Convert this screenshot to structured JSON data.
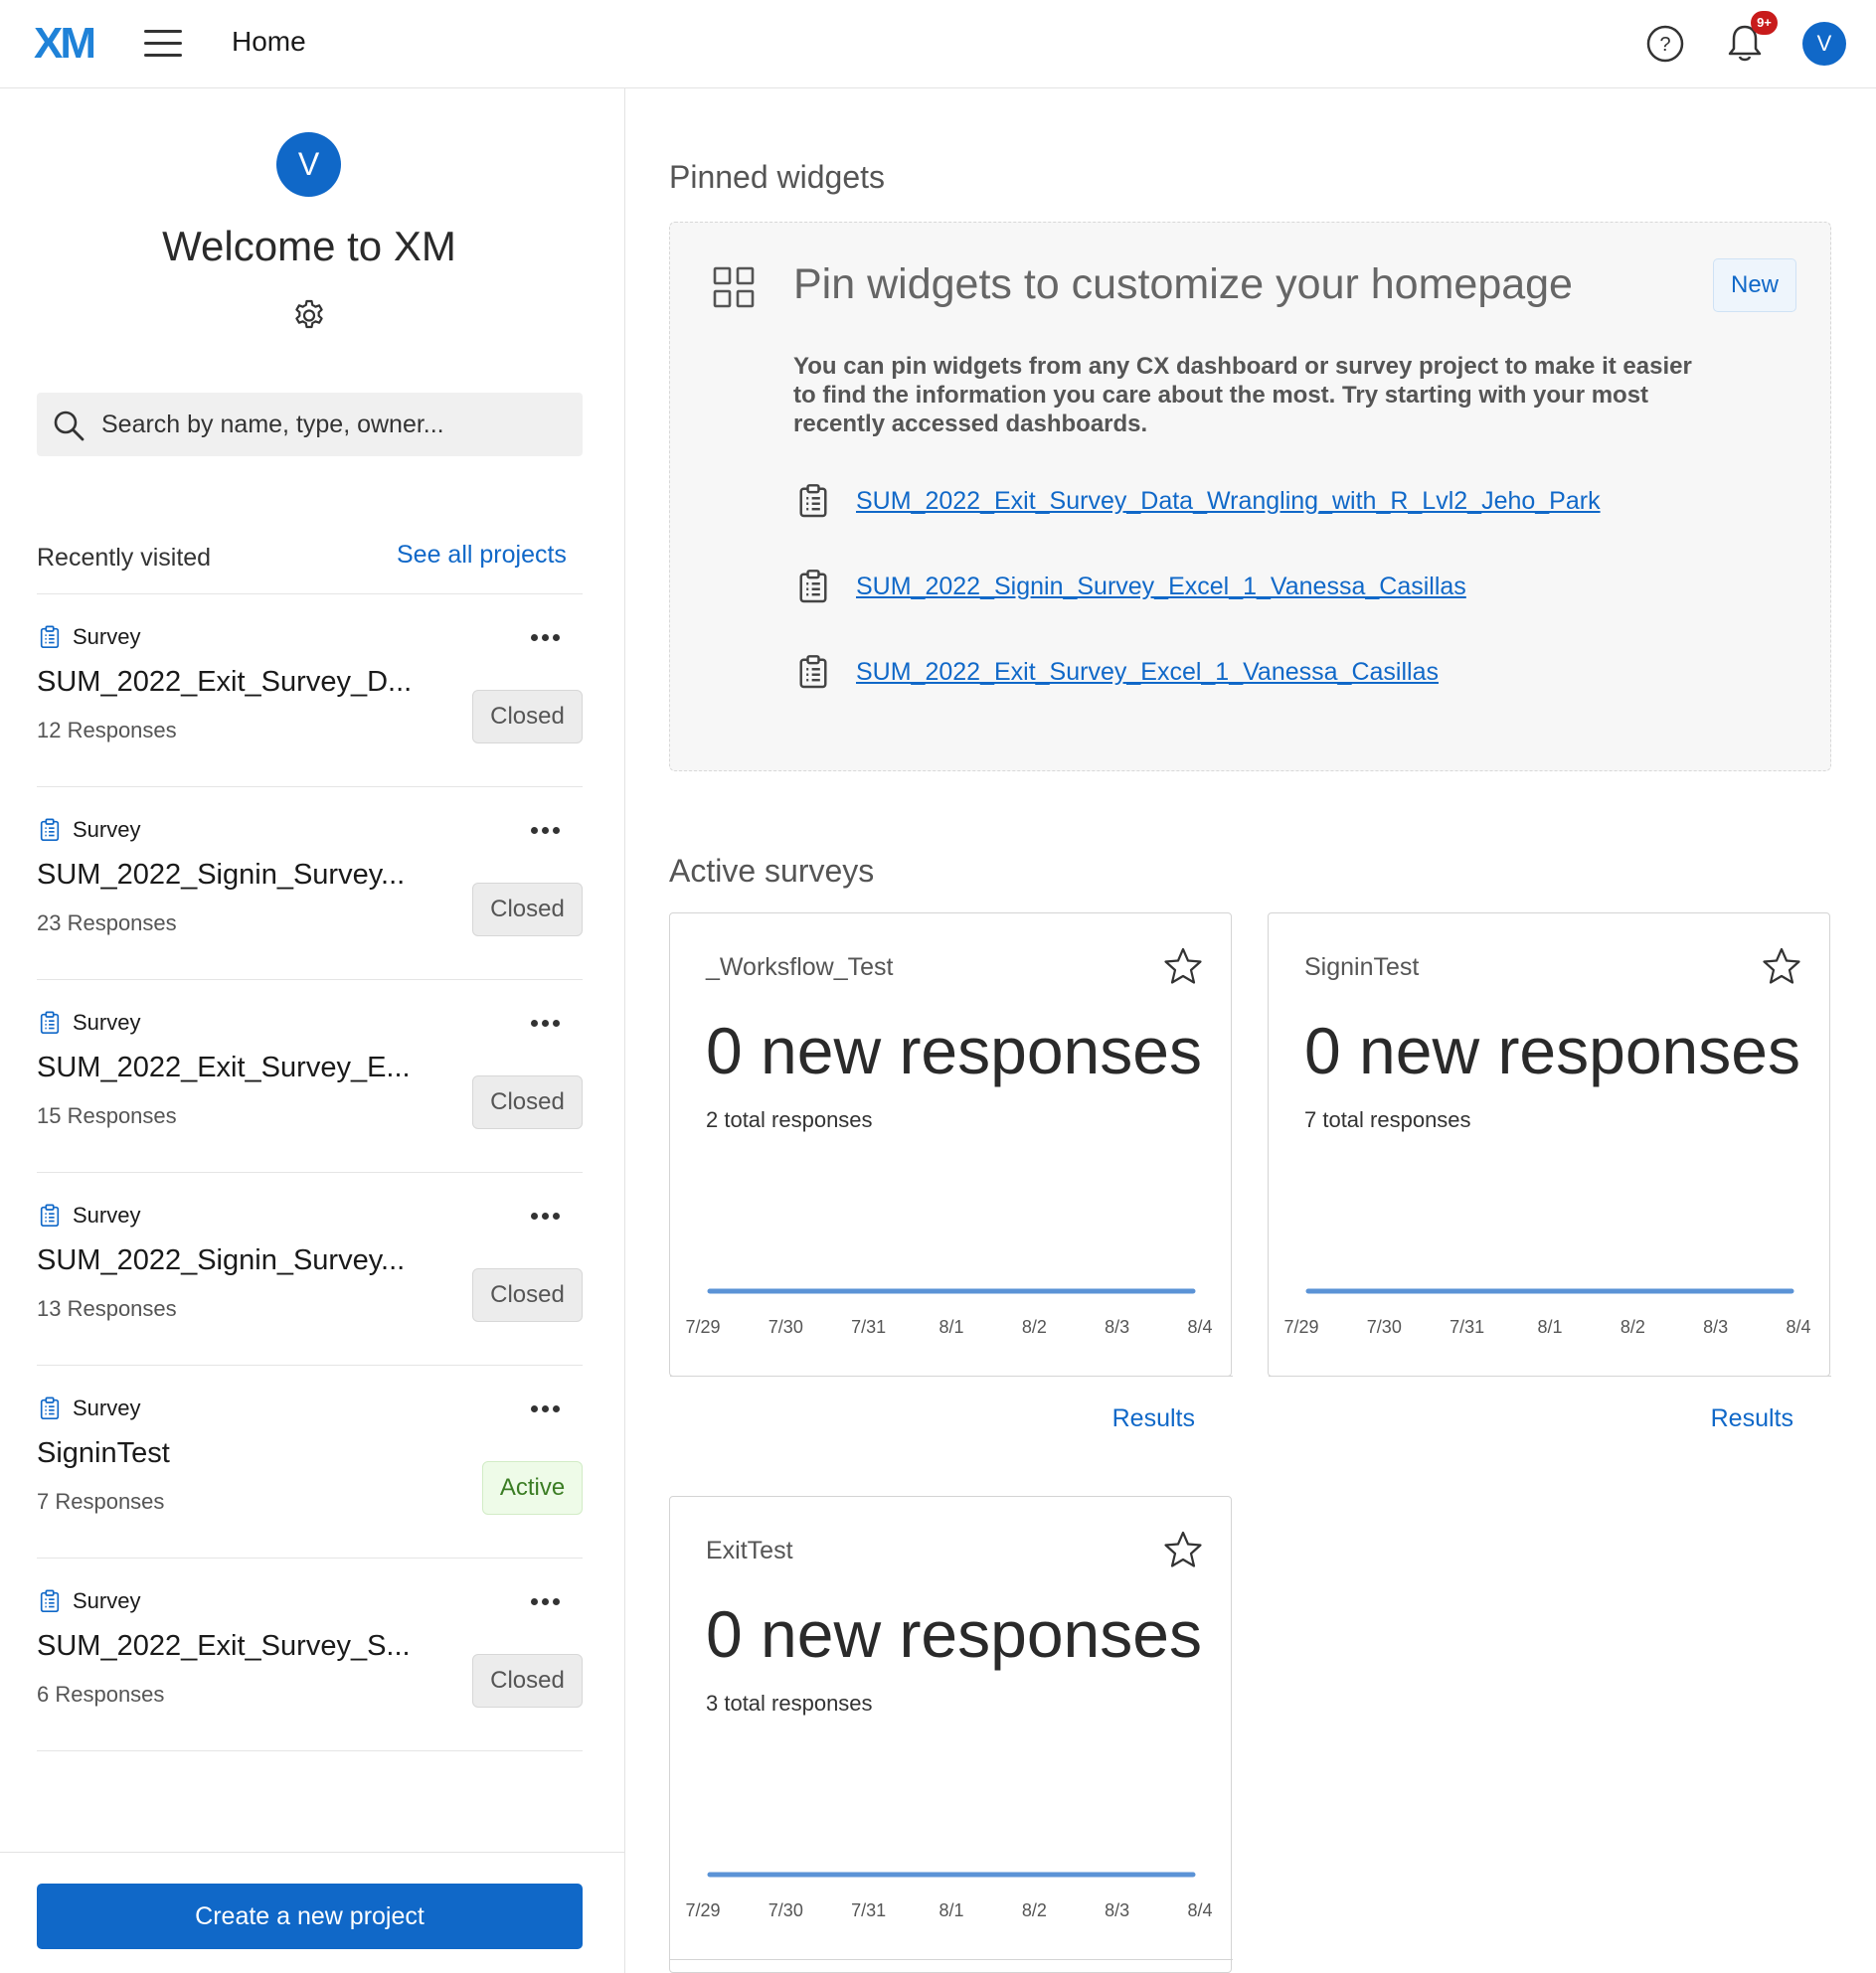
{
  "header": {
    "logo": "XM",
    "page_title": "Home",
    "notification_badge": "9+",
    "avatar_initial": "V"
  },
  "sidebar": {
    "avatar_initial": "V",
    "welcome": "Welcome to XM",
    "search_placeholder": "Search by name, type, owner...",
    "recently_visited_label": "Recently visited",
    "see_all_label": "See all projects",
    "projects": [
      {
        "type": "Survey",
        "name": "SUM_2022_Exit_Survey_D...",
        "responses": "12 Responses",
        "status": "Closed"
      },
      {
        "type": "Survey",
        "name": "SUM_2022_Signin_Survey...",
        "responses": "23 Responses",
        "status": "Closed"
      },
      {
        "type": "Survey",
        "name": "SUM_2022_Exit_Survey_E...",
        "responses": "15 Responses",
        "status": "Closed"
      },
      {
        "type": "Survey",
        "name": "SUM_2022_Signin_Survey...",
        "responses": "13 Responses",
        "status": "Closed"
      },
      {
        "type": "Survey",
        "name": "SigninTest",
        "responses": "7 Responses",
        "status": "Active"
      },
      {
        "type": "Survey",
        "name": "SUM_2022_Exit_Survey_S...",
        "responses": "6 Responses",
        "status": "Closed"
      }
    ],
    "create_button": "Create a new project"
  },
  "pinned": {
    "section_title": "Pinned widgets",
    "heading": "Pin widgets to customize your homepage",
    "badge": "New",
    "description": "You can pin widgets from any CX dashboard or survey project to make it easier to find the information you care about the most. Try starting with your most recently accessed dashboards.",
    "links": [
      "SUM_2022_Exit_Survey_Data_Wrangling_with_R_Lvl2_Jeho_Park",
      "SUM_2022_Signin_Survey_Excel_1_Vanessa_Casillas",
      "SUM_2022_Exit_Survey_Excel_1_Vanessa_Casillas"
    ]
  },
  "active_surveys": {
    "section_title": "Active surveys",
    "results_label": "Results",
    "cards": [
      {
        "name": "_Worksflow_Test",
        "new_responses": "0 new responses",
        "total": "2 total responses"
      },
      {
        "name": "SigninTest",
        "new_responses": "0 new responses",
        "total": "7 total responses"
      },
      {
        "name": "ExitTest",
        "new_responses": "0 new responses",
        "total": "3 total responses"
      }
    ]
  },
  "chart_data": [
    {
      "type": "line",
      "x": [
        "7/29",
        "7/30",
        "7/31",
        "8/1",
        "8/2",
        "8/3",
        "8/4"
      ],
      "series": [
        {
          "values": [
            0,
            0,
            0,
            0,
            0,
            0,
            0
          ]
        }
      ],
      "color": "#5b93d6"
    },
    {
      "type": "line",
      "x": [
        "7/29",
        "7/30",
        "7/31",
        "8/1",
        "8/2",
        "8/3",
        "8/4"
      ],
      "series": [
        {
          "values": [
            0,
            0,
            0,
            0,
            0,
            0,
            0
          ]
        }
      ],
      "color": "#5b93d6"
    },
    {
      "type": "line",
      "x": [
        "7/29",
        "7/30",
        "7/31",
        "8/1",
        "8/2",
        "8/3",
        "8/4"
      ],
      "series": [
        {
          "values": [
            0,
            0,
            0,
            0,
            0,
            0,
            0
          ]
        }
      ],
      "color": "#5b93d6"
    }
  ]
}
